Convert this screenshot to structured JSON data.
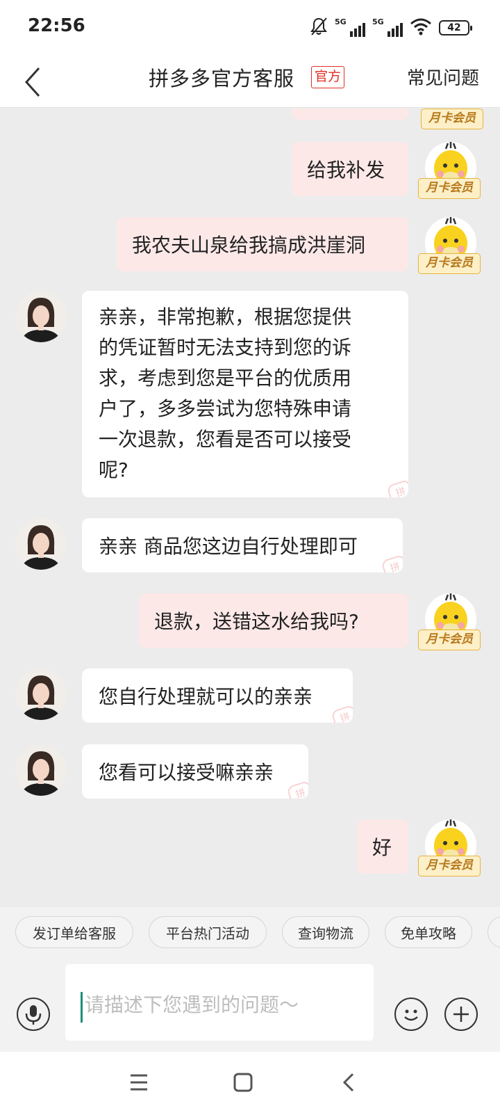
{
  "status_bar": {
    "time": "22:56",
    "network_1": "5G",
    "network_2": "5G",
    "battery": "42"
  },
  "header": {
    "title": "拼多多官方客服",
    "official_badge": "官方",
    "faq_link": "常见问题"
  },
  "member_badge": "月卡会员",
  "watermark": "拼",
  "messages": [
    {
      "sender": "user",
      "text": "给我补发"
    },
    {
      "sender": "user",
      "text": "我农夫山泉给我搞成洪崖洞"
    },
    {
      "sender": "agent",
      "lines": [
        "亲亲，非常抱歉，根据您提供",
        "的凭证暂时无法支持到您的诉",
        "求，考虑到您是平台的优质用",
        "户了，多多尝试为您特殊申请",
        "一次退款，您看是否可以接受",
        "呢?"
      ]
    },
    {
      "sender": "agent",
      "text": "亲亲 商品您这边自行处理即可"
    },
    {
      "sender": "user",
      "text": "退款，送错这水给我吗?"
    },
    {
      "sender": "agent",
      "text": "您自行处理就可以的亲亲"
    },
    {
      "sender": "agent",
      "text": "您看可以接受嘛亲亲"
    },
    {
      "sender": "user",
      "text": "好"
    }
  ],
  "quick_replies": [
    "发订单给客服",
    "平台热门活动",
    "查询物流",
    "免单攻略"
  ],
  "input": {
    "placeholder": "请描述下您遇到的问题～",
    "value": ""
  },
  "colors": {
    "accent_red": "#e02e24",
    "user_bubble": "#fde8e8",
    "agent_bubble": "#ffffff",
    "chat_bg": "#ececec",
    "caret": "#1a8f7a"
  }
}
